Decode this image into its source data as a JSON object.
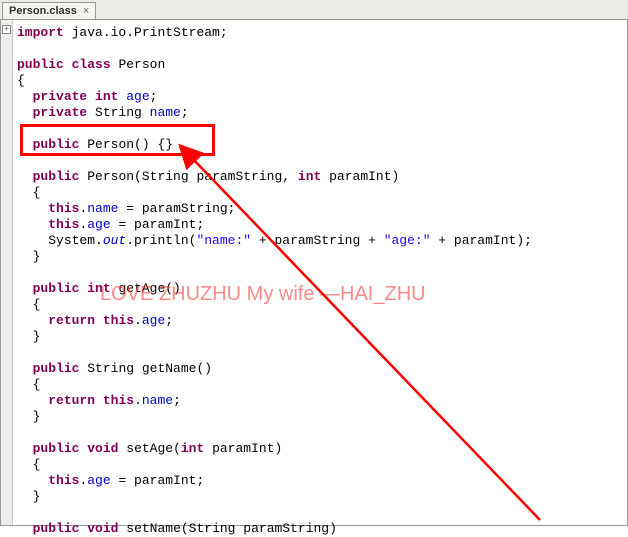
{
  "tab": {
    "label": "Person.class",
    "close": "×"
  },
  "fold": "+",
  "watermark": "LOVE ZHUZHU My wife —HAI_ZHU",
  "code": {
    "l1_import": "import",
    "l1_pkg": "java.io.PrintStream;",
    "l2_public": "public",
    "l2_class": "class",
    "l2_name": "Person",
    "l3": "{",
    "l4_priv": "private",
    "l4_int": "int",
    "l4_age": "age",
    "l5_priv": "private",
    "l5_str": "String",
    "l5_name": "name",
    "l6_public": "public",
    "l6_ctor": "Person() {}",
    "l7_public": "public",
    "l7_sig_a": "Person(String",
    "l7_sig_b": "paramString,",
    "l7_int": "int",
    "l7_sig_c": "paramInt)",
    "l8": "{",
    "l9_this": "this",
    "l9_name": "name",
    "l9_rest": " = paramString;",
    "l10_this": "this",
    "l10_age": "age",
    "l10_rest": " = paramInt;",
    "l11_a": "System.",
    "l11_out": "out",
    "l11_b": ".println(",
    "l11_s1": "\"name:\"",
    "l11_c": " + paramString + ",
    "l11_s2": "\"age:\"",
    "l11_d": " + paramInt);",
    "l12": "}",
    "l13_public": "public",
    "l13_int": "int",
    "l13_sig": "getAge()",
    "l14": "{",
    "l15_return": "return",
    "l15_this": "this",
    "l15_age": "age",
    "l16": "}",
    "l17_public": "public",
    "l17_str": "String getName()",
    "l18": "{",
    "l19_return": "return",
    "l19_this": "this",
    "l19_name": "name",
    "l20": "}",
    "l21_public": "public",
    "l21_void": "void",
    "l21_sig_a": "setAge(",
    "l21_int": "int",
    "l21_sig_b": " paramInt)",
    "l22": "{",
    "l23_this": "this",
    "l23_age": "age",
    "l23_rest": " = paramInt;",
    "l24": "}",
    "l25_public": "public",
    "l25_void": "void",
    "l25_sig": "setName(String paramString)"
  }
}
